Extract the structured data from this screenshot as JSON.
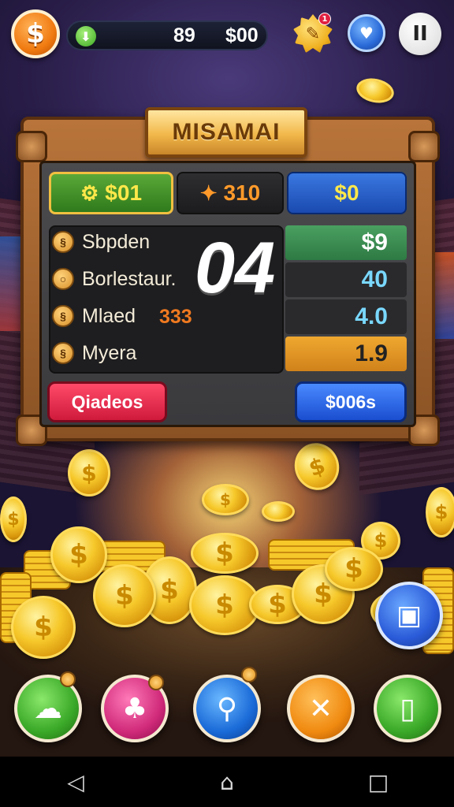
{
  "hud": {
    "plus_icon": "plus-icon",
    "value_a": "89",
    "value_b": "$00",
    "dollar_symbol": "$",
    "pause_symbol": "II",
    "notification_count": "1"
  },
  "panel": {
    "title": "MISAMAI",
    "top_cells": {
      "green": "$01",
      "dark": "310",
      "blue": "$0"
    },
    "big_number": "04",
    "rows": [
      {
        "label": "Sbpden",
        "icon": "swirl-icon"
      },
      {
        "label": "Borlestaur.",
        "icon": "ring-icon"
      },
      {
        "label": "Mlaed",
        "icon": "swirl-icon"
      },
      {
        "label": "Myera",
        "icon": "swirl-icon"
      }
    ],
    "row_extra_value": "333",
    "values": [
      "$9",
      "40",
      "4.0",
      "1.9"
    ],
    "buttons": {
      "left": "Qiadeos",
      "right": "$006s"
    }
  },
  "bottom_actions": [
    {
      "name": "farm-action-icon"
    },
    {
      "name": "piggy-bank-action-icon"
    },
    {
      "name": "search-action-icon"
    },
    {
      "name": "hammer-action-icon"
    },
    {
      "name": "card-action-icon"
    }
  ],
  "navbar": {
    "back": "◁",
    "home": "⌂",
    "recent": "□"
  },
  "colors": {
    "accent_gold": "#f6c82a",
    "wood": "#b8743a",
    "green_cell": "#5aa838",
    "blue_cell": "#3a78e0",
    "red_button": "#ff4a6a",
    "blue_button": "#4a8aff"
  }
}
